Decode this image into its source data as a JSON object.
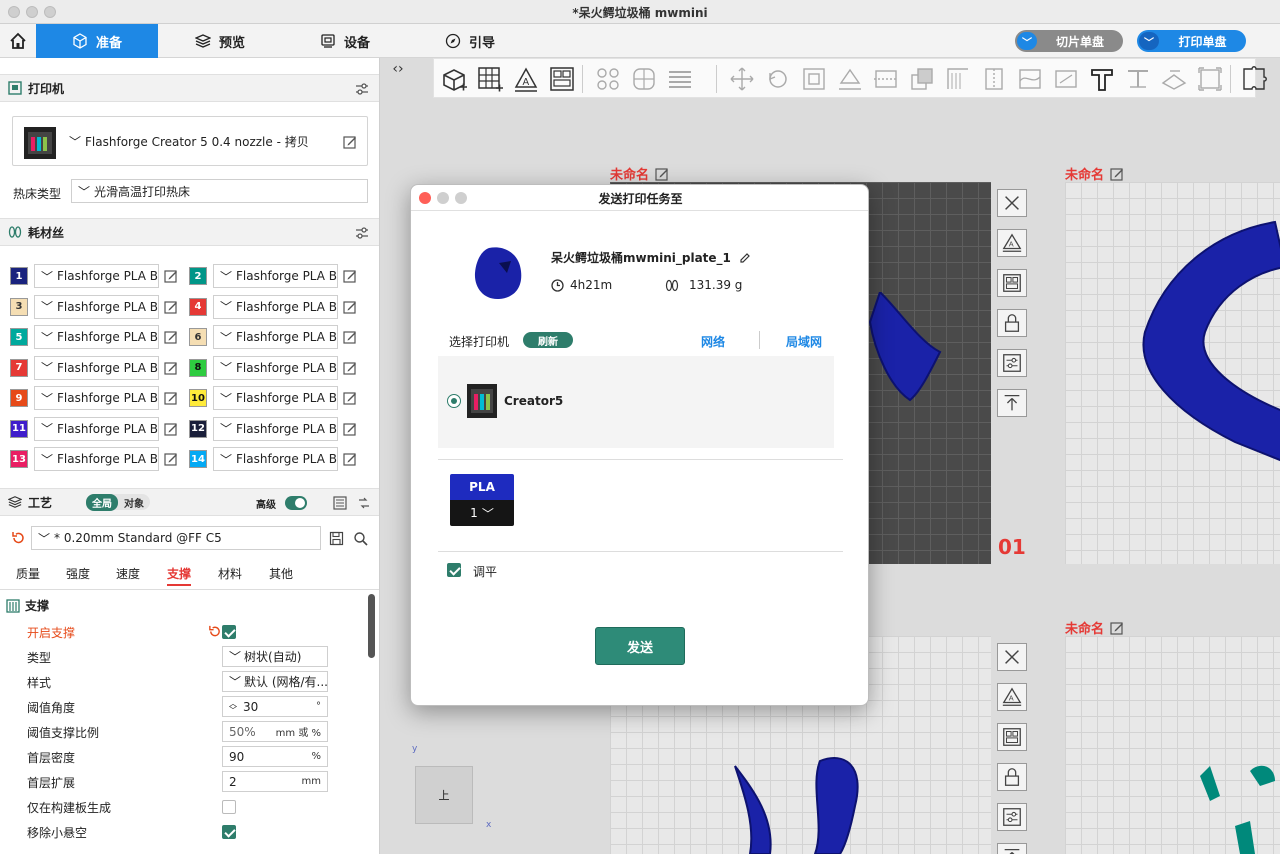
{
  "window": {
    "title": "*呆火鳄垃圾桶 mwmini"
  },
  "nav": {
    "tabs": [
      {
        "label": "准备",
        "icon": "cube-outline-icon",
        "active": true
      },
      {
        "label": "预览",
        "icon": "layers-icon",
        "active": false
      },
      {
        "label": "设备",
        "icon": "device-icon",
        "active": false
      },
      {
        "label": "引导",
        "icon": "compass-icon",
        "active": false
      }
    ],
    "slice_button": "切片单盘",
    "print_button": "打印单盘"
  },
  "printer": {
    "section_title": "打印机",
    "profile": "Flashforge Creator 5 0.4 nozzle - 拷贝",
    "bed_label": "热床类型",
    "bed_value": "光滑高温打印热床"
  },
  "filament": {
    "section_title": "耗材丝",
    "items": [
      {
        "num": "1",
        "color": "#1a237e",
        "text_color": "#ffffff",
        "name": "Flashforge PLA B..."
      },
      {
        "num": "2",
        "color": "#009688",
        "text_color": "#ffffff",
        "name": "Flashforge PLA Ba..."
      },
      {
        "num": "3",
        "color": "#f5deb3",
        "text_color": "#333333",
        "name": "Flashforge PLA B..."
      },
      {
        "num": "4",
        "color": "#e53935",
        "text_color": "#ffffff",
        "name": "Flashforge PLA Ba..."
      },
      {
        "num": "5",
        "color": "#00a99d",
        "text_color": "#ffffff",
        "name": "Flashforge PLA B..."
      },
      {
        "num": "6",
        "color": "#f5deb3",
        "text_color": "#333333",
        "name": "Flashforge PLA Ba..."
      },
      {
        "num": "7",
        "color": "#e53935",
        "text_color": "#ffffff",
        "name": "Flashforge PLA B..."
      },
      {
        "num": "8",
        "color": "#2ecc40",
        "text_color": "#111111",
        "name": "Flashforge PLA Ba..."
      },
      {
        "num": "9",
        "color": "#e64a19",
        "text_color": "#ffffff",
        "name": "Flashforge PLA B..."
      },
      {
        "num": "10",
        "color": "#ffeb3b",
        "text_color": "#111111",
        "name": "Flashforge PLA Ba..."
      },
      {
        "num": "11",
        "color": "#3f1dcb",
        "text_color": "#ffffff",
        "name": "Flashforge PLA B..."
      },
      {
        "num": "12",
        "color": "#1a1f3a",
        "text_color": "#ffffff",
        "name": "Flashforge PLA Ba..."
      },
      {
        "num": "13",
        "color": "#e91e63",
        "text_color": "#ffffff",
        "name": "Flashforge PLA B..."
      },
      {
        "num": "14",
        "color": "#03a9f4",
        "text_color": "#ffffff",
        "name": "Flashforge PLA Ba..."
      }
    ]
  },
  "process": {
    "section_title": "工艺",
    "global_label": "全局",
    "object_label": "对象",
    "advanced_label": "高级",
    "preset": "* 0.20mm Standard @FF C5",
    "tabs": [
      "质量",
      "强度",
      "速度",
      "支撑",
      "材料",
      "其他"
    ],
    "active_tab": "支撑",
    "group_title": "支撑",
    "props": {
      "enable_support": {
        "label": "开启支撑",
        "checked": true
      },
      "type": {
        "label": "类型",
        "value": "树状(自动)"
      },
      "style": {
        "label": "样式",
        "value": "默认 (网格/有..."
      },
      "threshold_angle": {
        "label": "阈值角度",
        "value": "30",
        "unit": "°"
      },
      "threshold_ratio": {
        "label": "阈值支撑比例",
        "value": "50%",
        "unit": "mm 或 %"
      },
      "first_layer_density": {
        "label": "首层密度",
        "value": "90",
        "unit": "%"
      },
      "first_layer_expansion": {
        "label": "首层扩展",
        "value": "2",
        "unit": "mm"
      },
      "only_build_plate": {
        "label": "仅在构建板生成",
        "checked": false
      },
      "remove_small_overhang": {
        "label": "移除小悬空",
        "checked": true
      }
    }
  },
  "canvas": {
    "plate_name": "未命名",
    "plate_number": "01",
    "axis_x": "x",
    "axis_y": "y",
    "view_label": "上"
  },
  "dialog": {
    "title": "发送打印任务至",
    "job_name": "呆火鳄垃圾桶mwmini_plate_1",
    "time": "4h21m",
    "weight": "131.39 g",
    "select_printer_label": "选择打印机",
    "refresh_label": "刷新",
    "network_label": "网络",
    "lan_label": "局域网",
    "printer_name": "Creator5",
    "material_type": "PLA",
    "material_slot": "1",
    "level_label": "调平",
    "level_checked": true,
    "send_label": "发送"
  },
  "colors": {
    "accent_blue": "#1e88e5",
    "accent_green": "#2e7d6b",
    "plate_red": "#e53935",
    "model_blue": "#1a22a8"
  }
}
